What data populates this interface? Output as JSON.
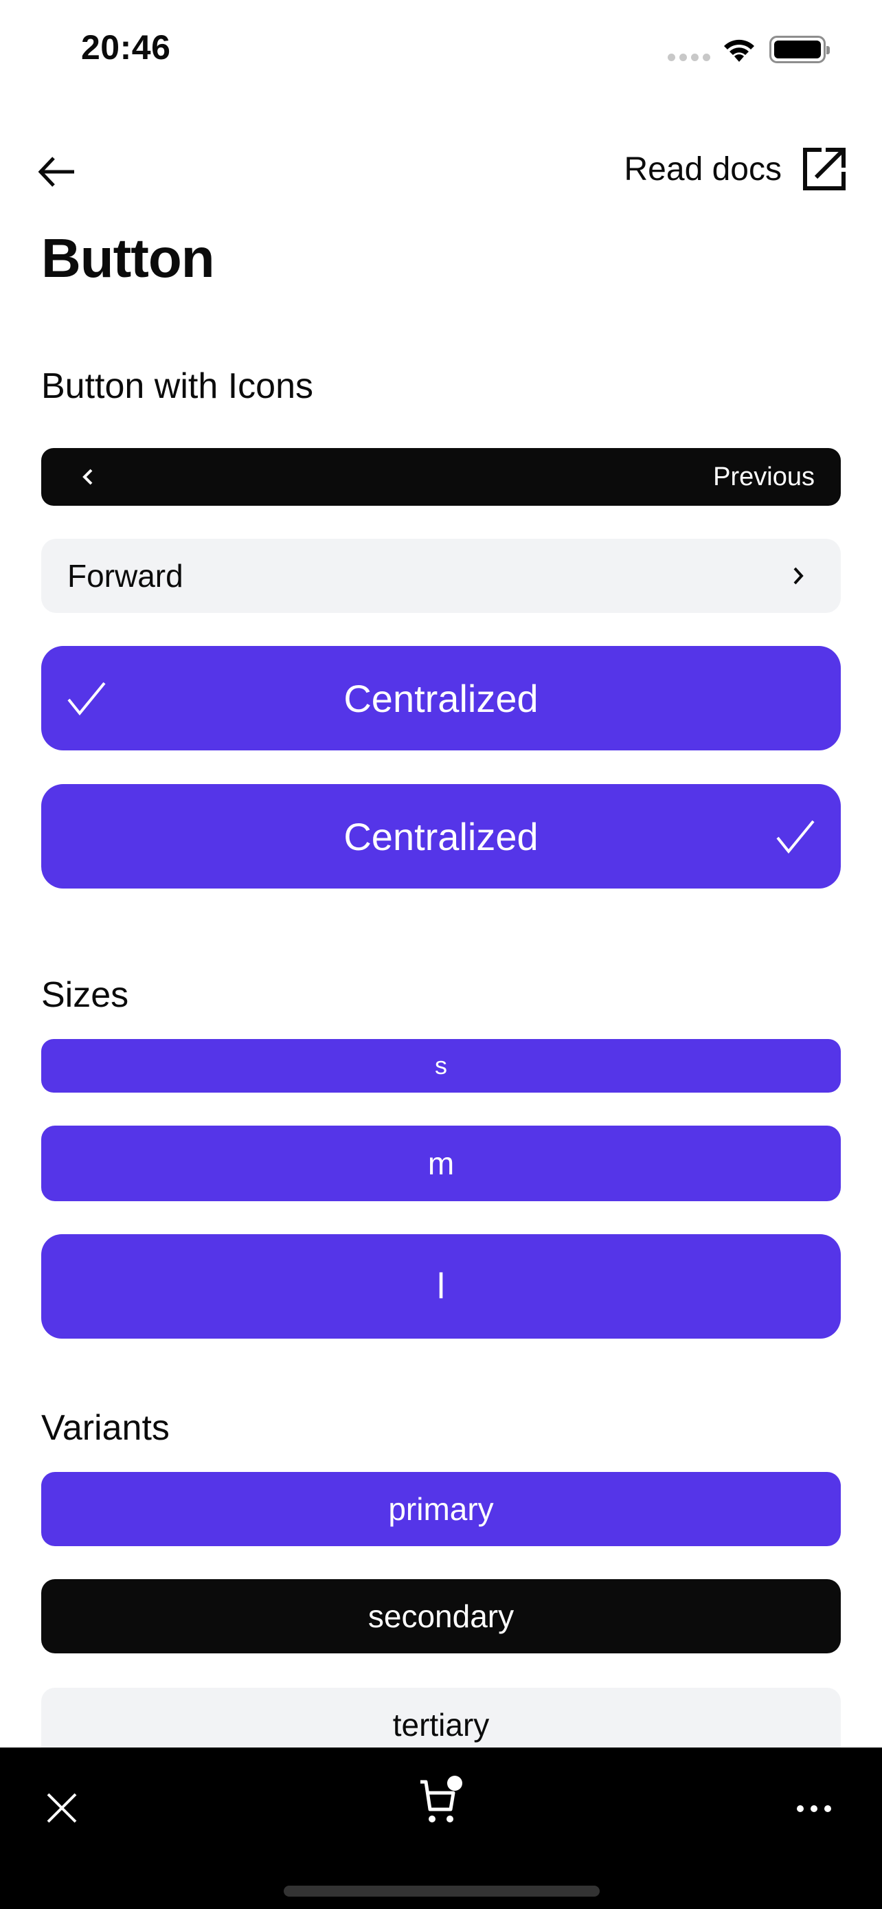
{
  "status_bar": {
    "time": "20:46",
    "signal_icon": "cellular-signal-icon",
    "wifi_icon": "wifi-icon",
    "battery_icon": "battery-icon"
  },
  "nav": {
    "back_icon": "arrow-left-icon",
    "read_docs_label": "Read docs",
    "external_link_icon": "external-link-icon"
  },
  "page": {
    "title": "Button"
  },
  "sections": {
    "icons": {
      "title": "Button with Icons",
      "buttons": [
        {
          "label": "Previous",
          "variant": "secondary",
          "icon": "chevron-left-icon",
          "icon_position": "left"
        },
        {
          "label": "Forward",
          "variant": "tertiary",
          "icon": "chevron-right-icon",
          "icon_position": "right"
        },
        {
          "label": "Centralized",
          "variant": "primary",
          "icon": "check-icon",
          "icon_position": "left"
        },
        {
          "label": "Centralized",
          "variant": "primary",
          "icon": "check-icon",
          "icon_position": "right"
        }
      ]
    },
    "sizes": {
      "title": "Sizes",
      "buttons": [
        {
          "label": "s",
          "variant": "primary"
        },
        {
          "label": "m",
          "variant": "primary"
        },
        {
          "label": "l",
          "variant": "primary"
        }
      ]
    },
    "variants": {
      "title": "Variants",
      "buttons": [
        {
          "label": "primary",
          "variant": "primary"
        },
        {
          "label": "secondary",
          "variant": "secondary"
        },
        {
          "label": "tertiary",
          "variant": "tertiary"
        }
      ]
    }
  },
  "bottom_bar": {
    "close_icon": "close-icon",
    "cart_icon": "cart-icon",
    "more_icon": "more-horizontal-icon"
  },
  "colors": {
    "primary": "#5535e8",
    "secondary": "#0b0b0b",
    "tertiary": "#f2f3f5",
    "text": "#0b0b0b",
    "bottom_bar": "#000000"
  }
}
